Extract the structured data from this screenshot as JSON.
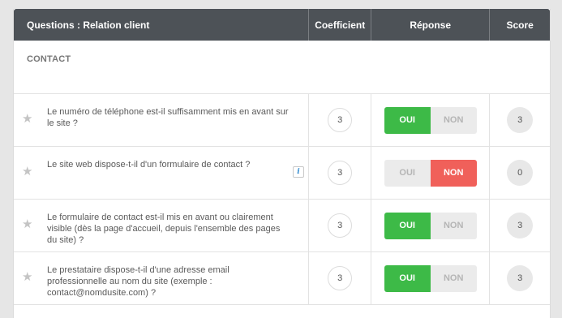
{
  "header": {
    "questions": "Questions : Relation client",
    "coefficient": "Coefficient",
    "reponse": "Réponse",
    "score": "Score"
  },
  "section": {
    "title": "CONTACT"
  },
  "toggle_labels": {
    "oui": "OUI",
    "non": "NON"
  },
  "colors": {
    "header_bg": "#4d5257",
    "oui_active": "#3dba47",
    "non_active": "#f0605a"
  },
  "rows": [
    {
      "question": "Le numéro de téléphone est-il suffisamment mis en avant sur le site ?",
      "coefficient": "3",
      "answer": "OUI",
      "score": "3",
      "info": false
    },
    {
      "question": "Le site web dispose-t-il d'un formulaire de contact ?",
      "coefficient": "3",
      "answer": "NON",
      "score": "0",
      "info": true
    },
    {
      "question": "Le formulaire de contact est-il mis en avant ou clairement visible (dès la page d'accueil, depuis l'ensemble des pages du site) ?",
      "coefficient": "3",
      "answer": "OUI",
      "score": "3",
      "info": false
    },
    {
      "question": "Le prestataire dispose-t-il d'une adresse email professionnelle au nom du site (exemple : contact@nomdusite.com) ?",
      "coefficient": "3",
      "answer": "OUI",
      "score": "3",
      "info": false
    }
  ]
}
